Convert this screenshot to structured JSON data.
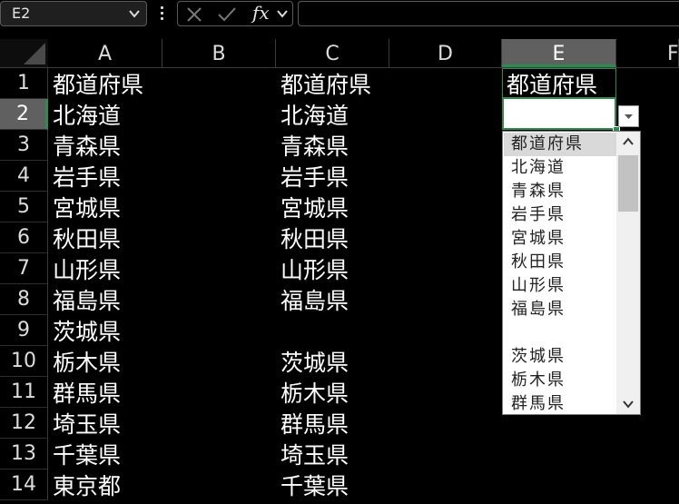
{
  "formula_bar": {
    "name_box": "E2",
    "fx_label": "fx",
    "formula": ""
  },
  "columns": [
    "A",
    "B",
    "C",
    "D",
    "E",
    "F"
  ],
  "active_column": "E",
  "rows": [
    "1",
    "2",
    "3",
    "4",
    "5",
    "6",
    "7",
    "8",
    "9",
    "10",
    "11",
    "12",
    "13",
    "14"
  ],
  "active_row": "2",
  "column_a": [
    "都道府県",
    "北海道",
    "青森県",
    "岩手県",
    "宮城県",
    "秋田県",
    "山形県",
    "福島県",
    "茨城県",
    "栃木県",
    "群馬県",
    "埼玉県",
    "千葉県",
    "東京都"
  ],
  "column_c": [
    "都道府県",
    "北海道",
    "青森県",
    "岩手県",
    "宮城県",
    "秋田県",
    "山形県",
    "福島県",
    "",
    "茨城県",
    "栃木県",
    "群馬県",
    "埼玉県",
    "千葉県"
  ],
  "column_e": [
    "都道府県",
    ""
  ],
  "dropdown": {
    "items": [
      "都道府県",
      "北海道",
      "青森県",
      "岩手県",
      "宮城県",
      "秋田県",
      "山形県",
      "福島県",
      "",
      "茨城県",
      "栃木県",
      "群馬県"
    ],
    "highlighted_index": 0
  },
  "colors": {
    "accent_green": "#2f8a4f",
    "header_active": "#606060",
    "background": "#000000"
  }
}
